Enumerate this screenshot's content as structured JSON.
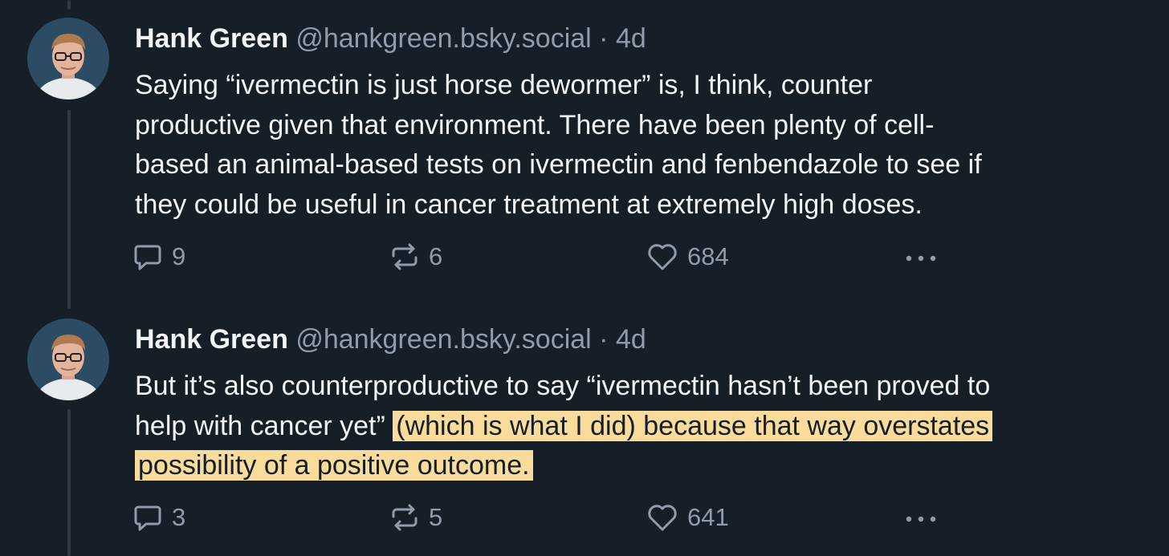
{
  "posts": [
    {
      "author": "Hank Green",
      "handle": "@hankgreen.bsky.social",
      "separator": "·",
      "time": "4d",
      "text_lines": [
        "Saying “ivermectin is just horse dewormer” is, I think, counter",
        "productive given that environment. There have been plenty of cell-",
        "based an animal-based tests on ivermectin and fenbendazole to see if",
        "they could be useful in cancer treatment at extremely high doses."
      ],
      "replies": "9",
      "reposts": "6",
      "likes": "684"
    },
    {
      "author": "Hank Green",
      "handle": "@hankgreen.bsky.social",
      "separator": "·",
      "time": "4d",
      "line1": "But it’s also counterproductive to say “ivermectin hasn’t been proved to",
      "line2_plain": "help with cancer yet” ",
      "line2_highlight": "(which is what I did) because that way overstates",
      "line3_highlight": "possibility of a positive outcome.",
      "replies": "3",
      "reposts": "5",
      "likes": "641"
    }
  ],
  "icons": [
    "reply-icon",
    "repost-icon",
    "like-icon",
    "more-icon"
  ],
  "colors": {
    "background": "#161e27",
    "text": "#f1f3f5",
    "muted": "#8f9cab",
    "highlight": "#f9dc9c",
    "thread_line": "#2e3a48"
  }
}
